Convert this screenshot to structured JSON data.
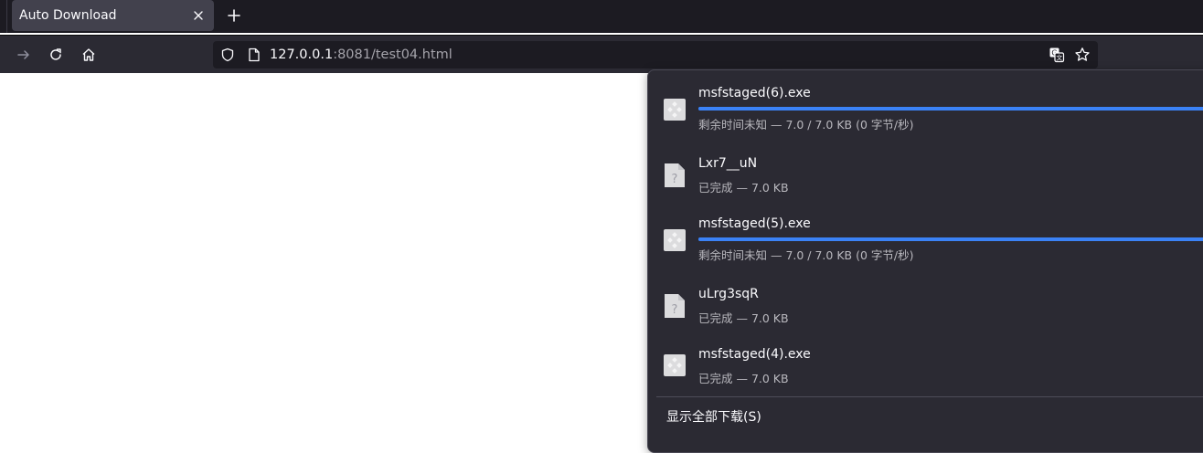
{
  "tab": {
    "title": "Auto Download"
  },
  "url": {
    "host": "127.0.0.1",
    "rest": ":8081/test04.html"
  },
  "downloads": {
    "items": [
      {
        "name": "msfstaged(6).exe",
        "status": "剩余时间未知 — 7.0 / 7.0 KB (0 字节/秒)",
        "type": "exe",
        "progress": 1.0
      },
      {
        "name": "Lxr7__uN",
        "status": "已完成 — 7.0 KB",
        "type": "unknown"
      },
      {
        "name": "msfstaged(5).exe",
        "status": "剩余时间未知 — 7.0 / 7.0 KB (0 字节/秒)",
        "type": "exe",
        "progress": 1.0
      },
      {
        "name": "uLrg3sqR",
        "status": "已完成 — 7.0 KB",
        "type": "unknown"
      },
      {
        "name": "msfstaged(4).exe",
        "status": "已完成 — 7.0 KB",
        "type": "exe"
      }
    ],
    "show_all_label": "显示全部下载(S)"
  },
  "colors": {
    "tabstrip_bg": "#1c1b22",
    "navbar_bg": "#2b2a33",
    "panel_bg": "#2b2a33",
    "progress": "#3b82f6"
  },
  "icons": {
    "tab_close": "close-icon",
    "new_tab": "plus-icon",
    "forward": "forward-arrow-icon",
    "reload": "reload-icon",
    "home": "home-icon",
    "tracking": "shield-icon",
    "page": "page-icon",
    "translate": "translate-icon",
    "bookmark": "star-icon",
    "exe_file": "executable-file-icon",
    "unknown_file": "unknown-file-icon"
  }
}
